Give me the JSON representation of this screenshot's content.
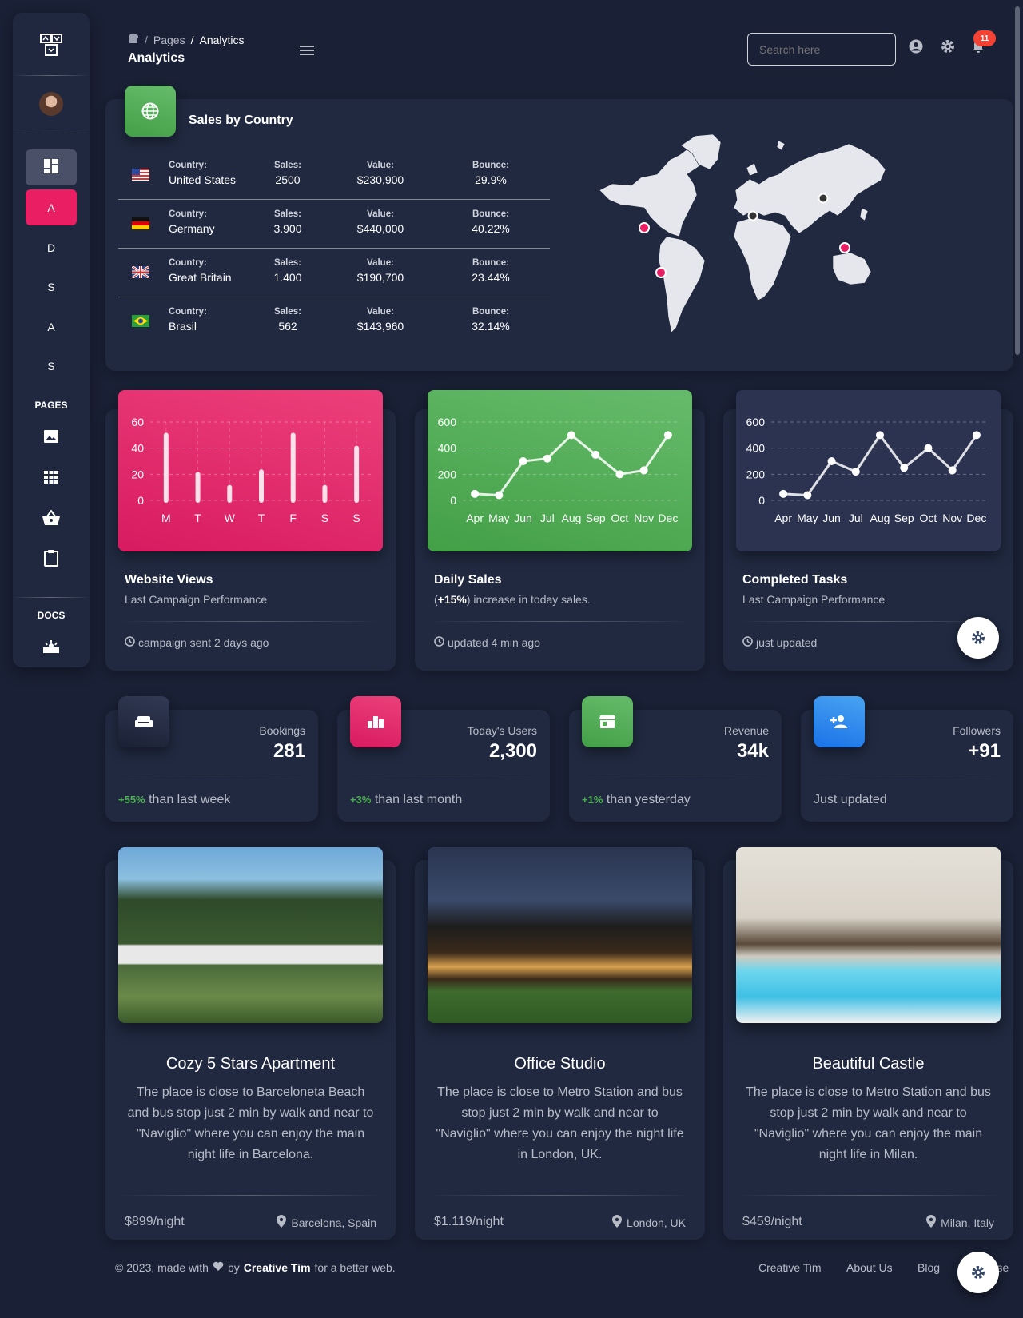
{
  "sidebar": {
    "brand_icon": "brand-logo",
    "avatar_icon": "user-avatar",
    "items": [
      {
        "label": "",
        "icon": "dashboard-icon",
        "active": true
      },
      {
        "label": "A",
        "highlight": true
      },
      {
        "label": "D"
      },
      {
        "label": "S"
      },
      {
        "label": "A"
      },
      {
        "label": "S"
      }
    ],
    "pages_heading": "PAGES",
    "page_icons": [
      "image-icon",
      "apps-icon",
      "basket-icon",
      "clipboard-icon"
    ],
    "docs_heading": "DOCS",
    "docs_icon": "getting-started-icon"
  },
  "topbar": {
    "breadcrumb": [
      "Pages",
      "Analytics"
    ],
    "breadcrumb_sep": "/",
    "page_title": "Analytics",
    "search_placeholder": "Search here",
    "notification_count": "11"
  },
  "sales_by_country": {
    "title": "Sales by Country",
    "column_labels": {
      "country": "Country:",
      "sales": "Sales:",
      "value": "Value:",
      "bounce": "Bounce:"
    },
    "rows": [
      {
        "flag": "US",
        "country": "United States",
        "sales": "2500",
        "value": "$230,900",
        "bounce": "29.9%"
      },
      {
        "flag": "DE",
        "country": "Germany",
        "sales": "3.900",
        "value": "$440,000",
        "bounce": "40.22%"
      },
      {
        "flag": "GB",
        "country": "Great Britain",
        "sales": "1.400",
        "value": "$190,700",
        "bounce": "23.44%"
      },
      {
        "flag": "BR",
        "country": "Brasil",
        "sales": "562",
        "value": "$143,960",
        "bounce": "32.14%"
      }
    ]
  },
  "chart_data": [
    {
      "type": "bar",
      "categories": [
        "M",
        "T",
        "W",
        "T",
        "F",
        "S",
        "S"
      ],
      "values": [
        50,
        20,
        10,
        22,
        50,
        10,
        40
      ],
      "ylim": [
        0,
        60
      ],
      "yticks": [
        "0",
        "20",
        "40",
        "60"
      ],
      "grid": true
    },
    {
      "type": "line",
      "categories": [
        "Apr",
        "May",
        "Jun",
        "Jul",
        "Aug",
        "Sep",
        "Oct",
        "Nov",
        "Dec"
      ],
      "values": [
        50,
        40,
        300,
        320,
        500,
        350,
        200,
        230,
        500
      ],
      "ylim": [
        0,
        600
      ],
      "yticks": [
        "0",
        "200",
        "400",
        "600"
      ],
      "grid": true
    },
    {
      "type": "line",
      "categories": [
        "Apr",
        "May",
        "Jun",
        "Jul",
        "Aug",
        "Sep",
        "Oct",
        "Nov",
        "Dec"
      ],
      "values": [
        50,
        40,
        300,
        220,
        500,
        250,
        400,
        230,
        500
      ],
      "ylim": [
        0,
        600
      ],
      "yticks": [
        "0",
        "200",
        "400",
        "600"
      ],
      "grid": true
    }
  ],
  "chart_cards": [
    {
      "title": "Website Views",
      "subtitle": "Last Campaign Performance",
      "footer": "campaign sent 2 days ago",
      "color": "#e91e63"
    },
    {
      "title": "Daily Sales",
      "subtitle_bold": "+15%",
      "subtitle_rest": ") increase in today sales.",
      "subtitle_open": "(",
      "footer": "updated 4 min ago",
      "color": "#4caf50"
    },
    {
      "title": "Completed Tasks",
      "subtitle": "Last Campaign Performance",
      "footer": "just updated",
      "color": "#2b3350"
    }
  ],
  "stats": [
    {
      "label": "Bookings",
      "value": "281",
      "delta": "+55%",
      "note": " than last week",
      "icon": "weekend-icon",
      "color": "#2b3350"
    },
    {
      "label": "Today's Users",
      "value": "2,300",
      "delta": "+3%",
      "note": " than last month",
      "icon": "leaderboard-icon",
      "color": "#e91e63"
    },
    {
      "label": "Revenue",
      "value": "34k",
      "delta": "+1%",
      "note": " than yesterday",
      "icon": "store-icon",
      "color": "#4caf50"
    },
    {
      "label": "Followers",
      "value": "+91",
      "delta": "",
      "note": "Just updated",
      "icon": "person-add-icon",
      "color": "#1a73e8"
    }
  ],
  "properties": [
    {
      "title": "Cozy 5 Stars Apartment",
      "description": "The place is close to Barceloneta Beach and bus stop just 2 min by walk and near to \"Naviglio\" where you can enjoy the main night life in Barcelona.",
      "price": "$899/night",
      "location": "Barcelona, Spain"
    },
    {
      "title": "Office Studio",
      "description": "The place is close to Metro Station and bus stop just 2 min by walk and near to \"Naviglio\" where you can enjoy the night life in London, UK.",
      "price": "$1.119/night",
      "location": "London, UK"
    },
    {
      "title": "Beautiful Castle",
      "description": "The place is close to Metro Station and bus stop just 2 min by walk and near to \"Naviglio\" where you can enjoy the main night life in Milan.",
      "price": "$459/night",
      "location": "Milan, Italy"
    }
  ],
  "footer": {
    "copyright_pre": "© 2023, made with",
    "copyright_by": "by",
    "author": "Creative Tim",
    "copyright_post": "for a better web.",
    "links": [
      "Creative Tim",
      "About Us",
      "Blog",
      "License"
    ]
  }
}
